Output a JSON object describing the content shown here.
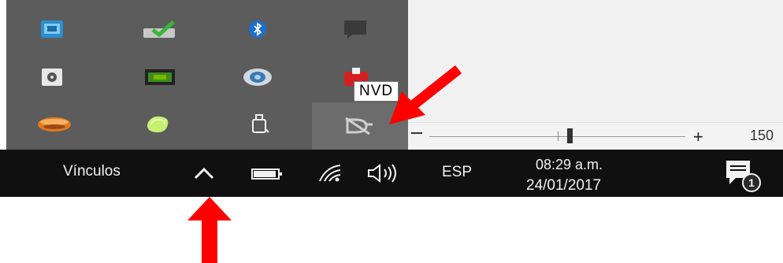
{
  "tray_popup": {
    "icons": [
      {
        "name": "network-monitor-icon"
      },
      {
        "name": "checkmark-drive-icon"
      },
      {
        "name": "bluetooth-icon"
      },
      {
        "name": "chat-bubble-icon"
      },
      {
        "name": "hard-drive-icon"
      },
      {
        "name": "nvidia-icon"
      },
      {
        "name": "webcam-icon"
      },
      {
        "name": "red-app-icon"
      },
      {
        "name": "orange-disc-icon"
      },
      {
        "name": "green-shape-icon"
      },
      {
        "name": "usb-drive-icon"
      },
      {
        "name": "nvidia-3d-vision-icon"
      }
    ]
  },
  "tooltip": {
    "text": "NVD"
  },
  "zoom": {
    "value_label": "150",
    "level_fraction": 0.52
  },
  "taskbar": {
    "links_label": "Vínculos",
    "language": "ESP",
    "time": "08:29 a.m.",
    "date": "24/01/2017",
    "notification_count": "1"
  },
  "colors": {
    "tray_bg": "#5c5c5c",
    "taskbar_bg": "#101010",
    "annotation_arrow": "#ff0000"
  }
}
